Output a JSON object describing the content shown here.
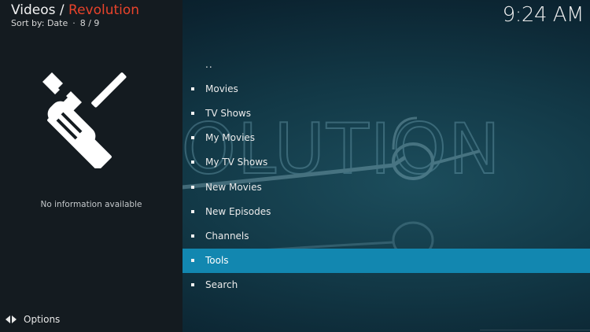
{
  "header": {
    "section": "Videos",
    "separator": " / ",
    "addon": "Revolution",
    "sort_label": "Sort by: Date",
    "sort_dot": "·",
    "position": "8 / 9"
  },
  "clock": "9:24 AM",
  "info_panel": {
    "thumbnail_icon": "tools-icon",
    "no_info": "No information available"
  },
  "footer": {
    "options_label": "Options",
    "options_icon": "options-arrows-icon"
  },
  "menu": {
    "parent": "..",
    "items": [
      {
        "label": "Movies"
      },
      {
        "label": "TV Shows"
      },
      {
        "label": "My Movies"
      },
      {
        "label": "My TV Shows"
      },
      {
        "label": "New Movies"
      },
      {
        "label": "New Episodes"
      },
      {
        "label": "Channels"
      },
      {
        "label": "Tools",
        "selected": true
      },
      {
        "label": "Search"
      }
    ]
  },
  "colors": {
    "accent": "#e8432b",
    "selection": "#1287b0",
    "left_panel": "#141b20"
  }
}
